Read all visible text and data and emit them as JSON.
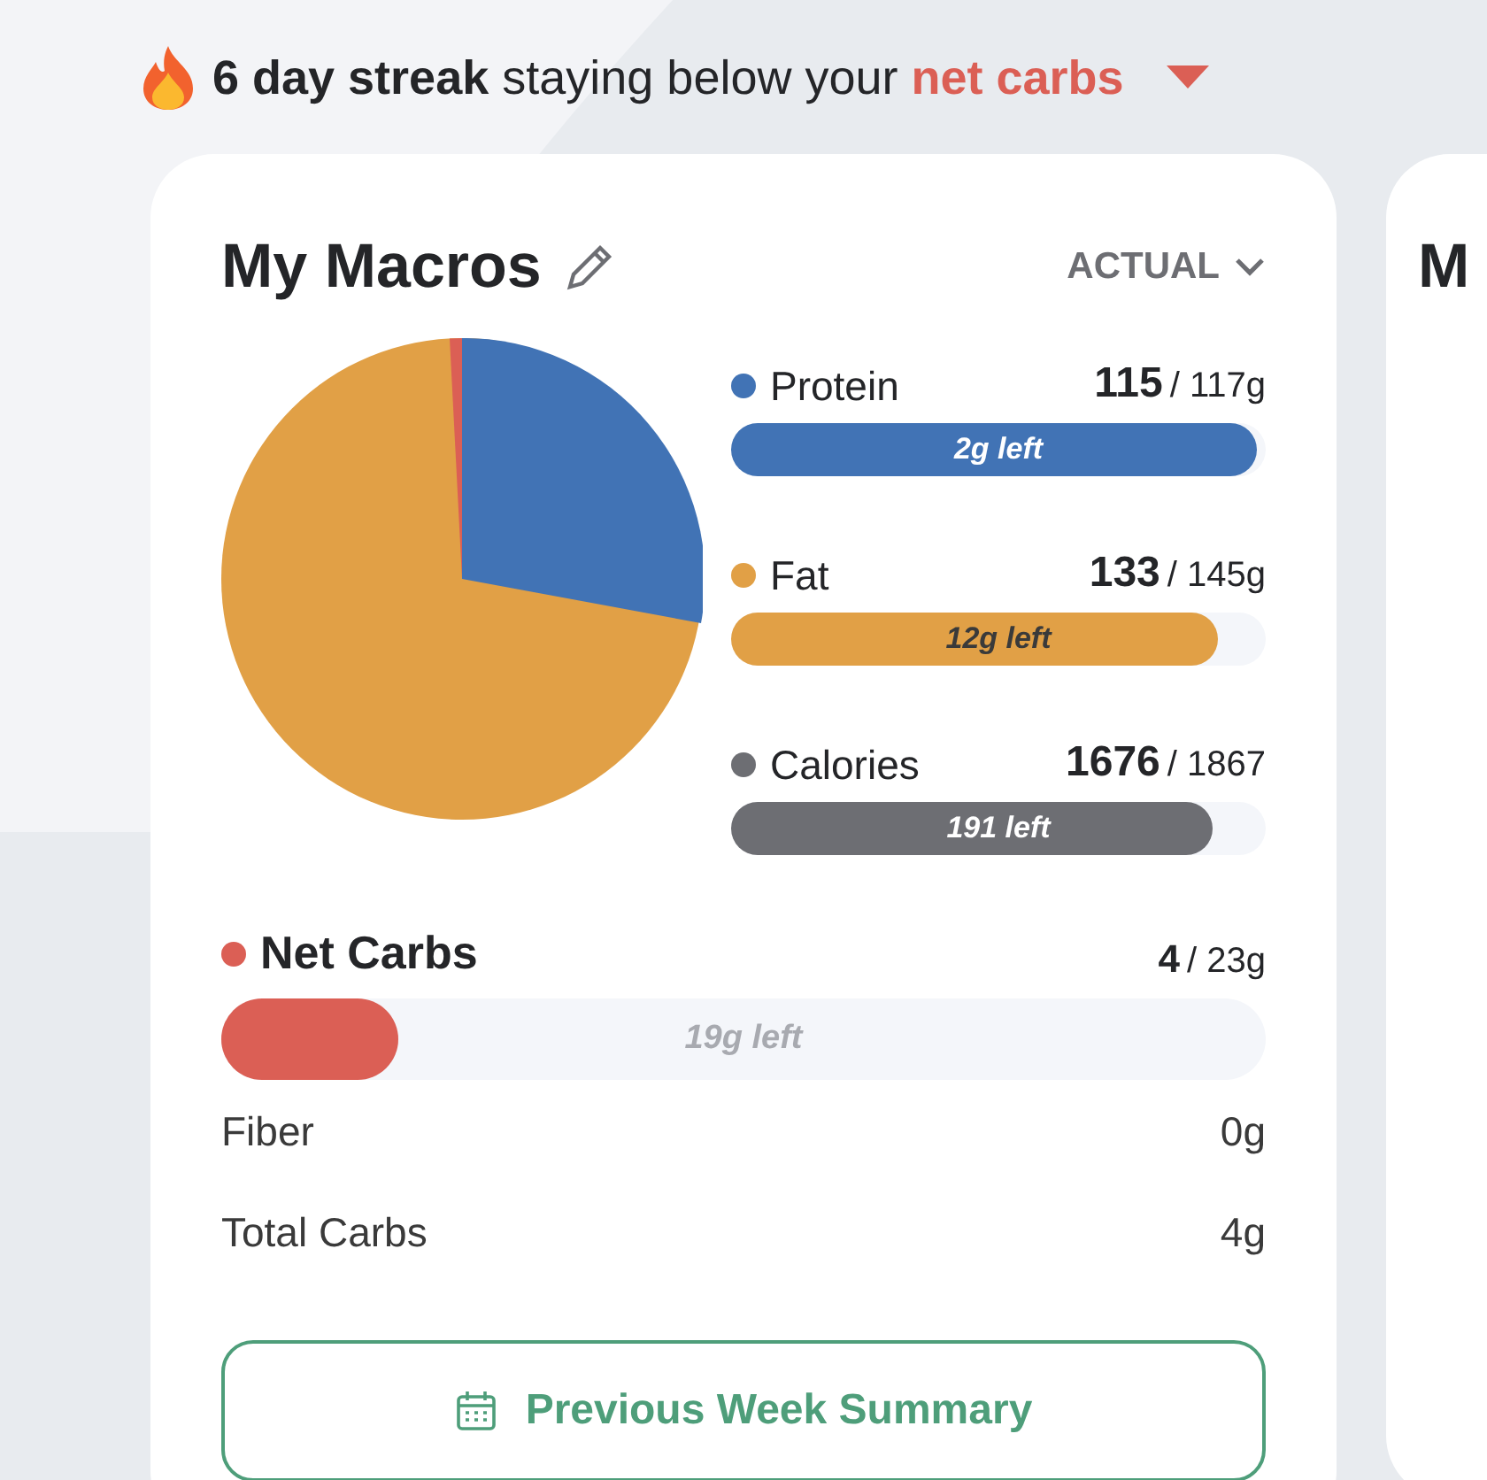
{
  "streak": {
    "bold": "6 day streak",
    "text": "staying below your",
    "highlight": "net carbs"
  },
  "card": {
    "title": "My Macros",
    "mode": "ACTUAL",
    "macros": [
      {
        "name": "Protein",
        "color": "#4173b5",
        "value": "115",
        "target": "/ 117g",
        "level": 0.985,
        "left": "2g left"
      },
      {
        "name": "Fat",
        "color": "#e1a046",
        "value": "133",
        "target": "/ 145g",
        "level": 0.91,
        "left": "12g left"
      },
      {
        "name": "Calories",
        "color": "#6d6e73",
        "value": "1676",
        "target": "/ 1867",
        "level": 0.9,
        "left": "191 left"
      }
    ],
    "net_carbs": {
      "name": "Net Carbs",
      "color": "#db5f55",
      "value": "4",
      "target": "/ 23g",
      "level": 0.17,
      "left": "19g left"
    },
    "details": [
      {
        "label": "Fiber",
        "value": "0g"
      },
      {
        "label": "Total Carbs",
        "value": "4g"
      }
    ],
    "button": "Previous Week Summary"
  },
  "next_card": {
    "title": "M"
  }
}
